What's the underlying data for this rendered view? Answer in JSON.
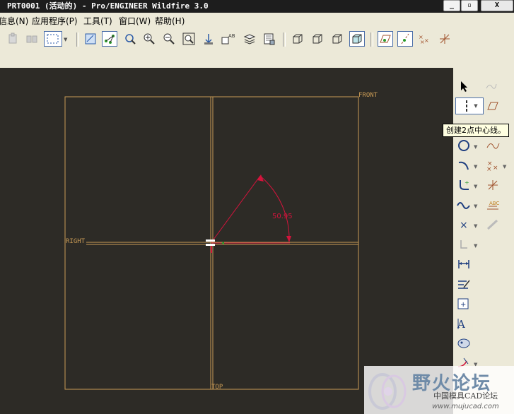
{
  "window": {
    "title": "PRT0001 (活动的) - Pro/ENGINEER Wildfire 3.0",
    "minimize_label": "_",
    "restore_label": "▫",
    "close_label": "X"
  },
  "menu": {
    "items": [
      "信息(N)",
      "应用程序(P)",
      "工具(T)",
      "窗口(W)",
      "帮助(H)"
    ]
  },
  "sketch": {
    "datum_front": "FRONT",
    "datum_right": "RIGHT",
    "datum_top": "TOP",
    "angle_dimension": "50.95",
    "colors": {
      "background": "#2d2b26",
      "datum": "#c99b55",
      "sketch": "#d3143c",
      "highlight": "#ffffff"
    }
  },
  "tooltip": {
    "text": "创建2点中心线。"
  },
  "watermark": {
    "title": "野火论坛",
    "subtitle": "中国模具CAD论坛",
    "url": "www.mujucad.com"
  }
}
